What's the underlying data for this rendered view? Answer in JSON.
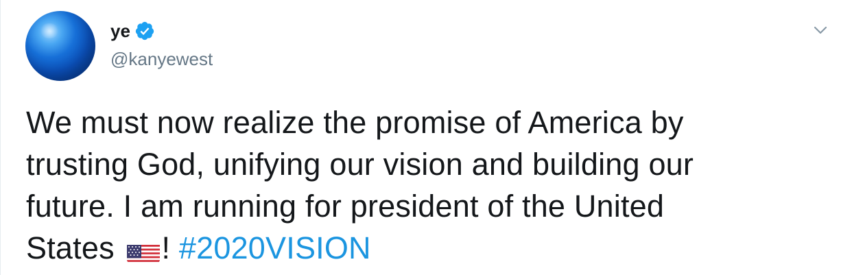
{
  "tweet": {
    "author": {
      "display_name": "ye",
      "handle": "@kanyewest",
      "verified": true
    },
    "text": {
      "line1": "We must now realize the promise of America by",
      "line2": "trusting God, unifying our vision and building our",
      "line3": "future. I am running for president of the United",
      "line4_pre": "States ",
      "flag_emoji": "us-flag-emoji",
      "line4_post": "! ",
      "hashtag": "#2020VISION"
    }
  },
  "icons": {
    "verified": "verified-badge-icon",
    "caret": "chevron-down-icon"
  },
  "colors": {
    "link": "#1b95e0",
    "handle": "#657786",
    "text": "#14171a",
    "verified": "#1da1f2"
  }
}
